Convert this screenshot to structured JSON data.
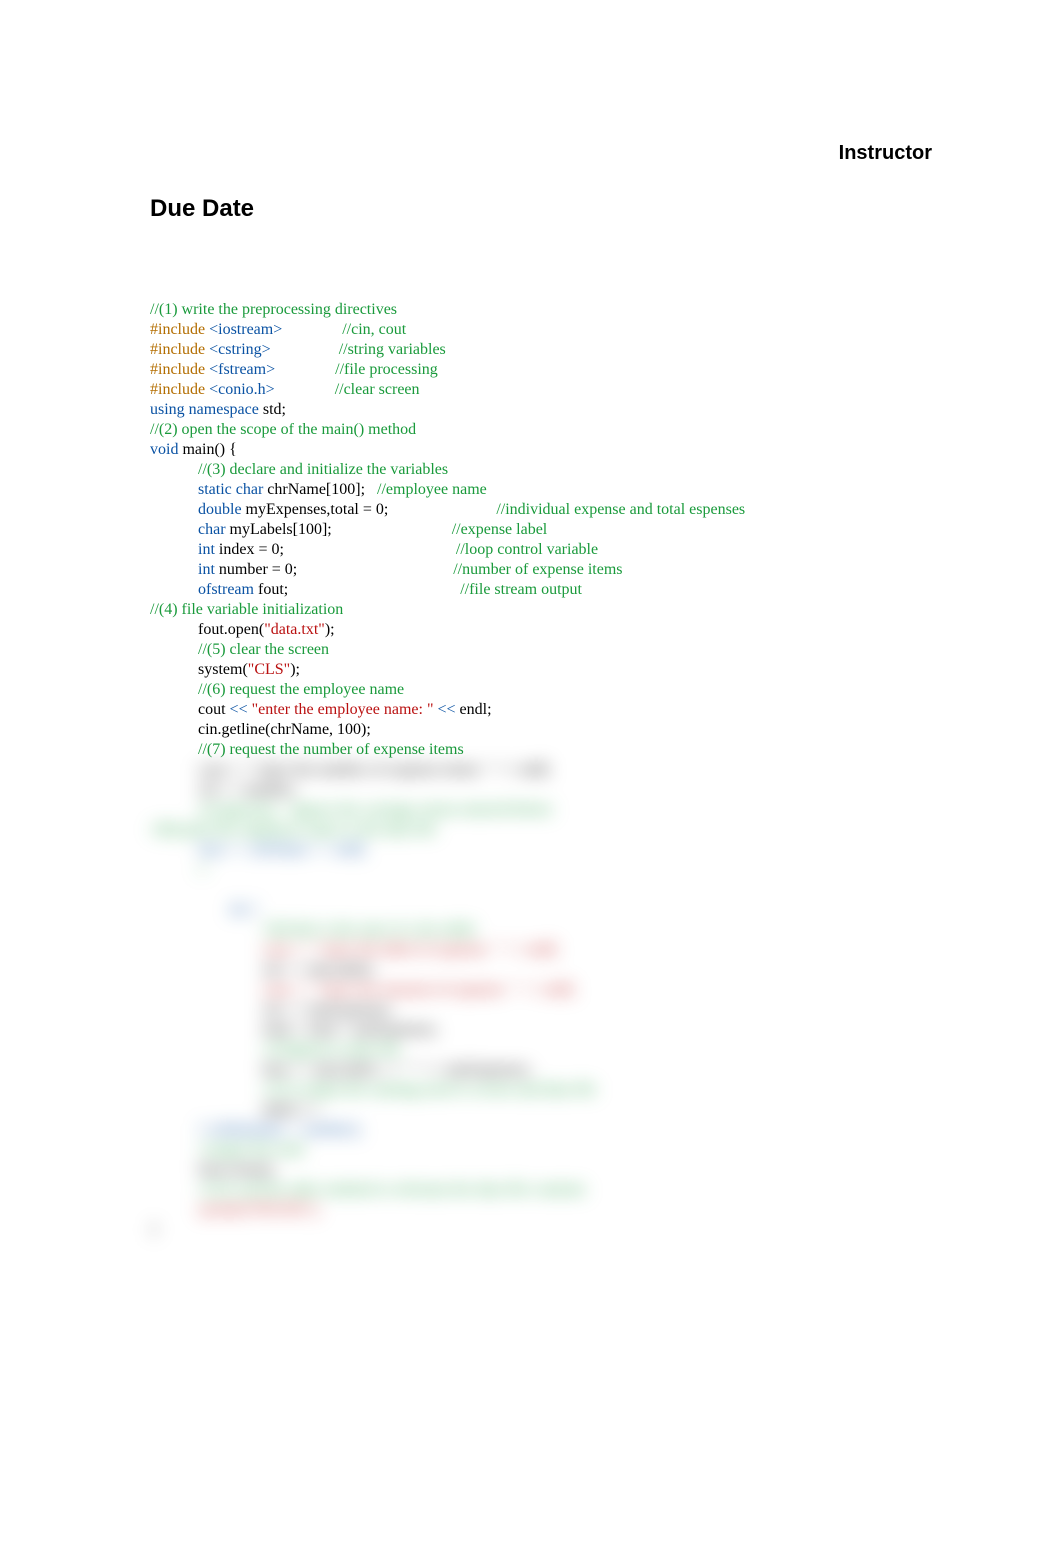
{
  "header": {
    "instructor_label": "Instructor",
    "due_date_label": "Due Date"
  },
  "code": {
    "l1": "//(1) write the preprocessing directives",
    "inc": "#include",
    "hdr_iostream": "<iostream>",
    "hdr_cstring": "<cstring>",
    "hdr_fstream": "<fstream>",
    "hdr_conio": "<conio.h>",
    "c_cin": "//cin, cout",
    "c_string": "//string variables",
    "c_file": "//file processing",
    "c_clear": "//clear screen",
    "using": "using namespace",
    "std": "std;",
    "c2": "//(2) open the scope of the main() method",
    "void": "void",
    "mainsig": "main() {",
    "c3": "//(3) declare and initialize the variables",
    "static_char": "static char",
    "chrName": " chrName[100];   ",
    "c_emp": "//employee name",
    "double": "double",
    "myExp": " myExpenses,total = 0;",
    "c_ind": "//individual expense and total espenses",
    "char": "char",
    "labels": " myLabels[100];",
    "c_label": "//expense label",
    "int": "int",
    "index": " index = 0;",
    "c_loop": "//loop control variable",
    "number": " number = 0;",
    "c_num": "//number of expense items",
    "ofstream": "ofstream",
    "fout": " fout;",
    "c_stream": "//file stream output",
    "c4": "//(4) file variable initialization",
    "foutopen_a": "fout.open(",
    "foutopen_b": "\"data.txt\"",
    "foutopen_c": ");",
    "c5": "//(5) clear the screen",
    "sys_a": "system(",
    "sys_b": "\"CLS\"",
    "sys_c": ");",
    "c6": "//(6) request the employee name",
    "cout": "cout",
    "lt": " << ",
    "str_emp": "\"enter the employee name: \"",
    "ltendl": " <<",
    "endl": "endl;",
    "getline": "cin.getline(chrName, 100);",
    "c7": "//(7) request the number of expense items"
  },
  "blurred": {
    "b1": "cout << \"enter the number of expense items: \" << endl;",
    "b2": "cin >> number;",
    "b3": "cin.ignore();  //ignore the carriage return entered before",
    "b4": "//(8) print the employee name to the data file",
    "b5": "fout << chrName << endl;",
    "b6": "//",
    "b7_do": "do {",
    "b8": "        //(9) this is the start of a do-while",
    "b9": "        cout << \"enter the label of expense: \" << endl;",
    "b10": "        cin >> myLabels;",
    "b11": "        cout << \"enter the amount of expense: \" << endl;",
    "b12": "        cin >> myExpenses;",
    "b13": "        total = total + myExpenses;",
    "b14": "        //(10)print to data file",
    "b15": "        fout << myLabels << \" \" << myExpenses;",
    "b16": "        //(11) output the running total to screen and data file",
    "b17": "        index++;",
    "b18_while": "} while(index < number);",
    "b19": "//output the total",
    "b20": "fout.close();",
    "b21": "//(12) call the other method to reformat the data file contents",
    "b22": "system(\"PAUSE\");",
    "b23": "}"
  }
}
